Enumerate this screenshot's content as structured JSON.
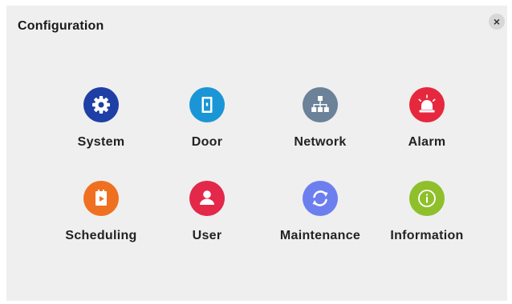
{
  "dialog": {
    "title": "Configuration",
    "close_label": "×"
  },
  "items": [
    {
      "label": "System",
      "icon": "gear-icon",
      "color": "#1e3fa6"
    },
    {
      "label": "Door",
      "icon": "door-icon",
      "color": "#1a96d6"
    },
    {
      "label": "Network",
      "icon": "network-icon",
      "color": "#6b8299"
    },
    {
      "label": "Alarm",
      "icon": "alarm-siren-icon",
      "color": "#e6283f"
    },
    {
      "label": "Scheduling",
      "icon": "schedule-icon",
      "color": "#f07021"
    },
    {
      "label": "User",
      "icon": "user-icon",
      "color": "#e3284a"
    },
    {
      "label": "Maintenance",
      "icon": "sync-icon",
      "color": "#6d7fef"
    },
    {
      "label": "Information",
      "icon": "info-icon",
      "color": "#8fbf2b"
    }
  ]
}
